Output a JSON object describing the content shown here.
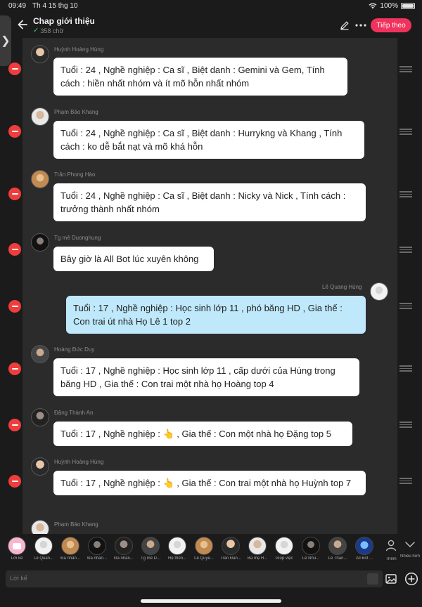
{
  "status": {
    "time": "09:49",
    "date": "Th 4 15 thg 10",
    "battery": "100%",
    "battery_level": 1.0
  },
  "header": {
    "title": "Chap giới thiệu",
    "word_count": "358 chữ",
    "follow_label": "Tiếp theo"
  },
  "messages": [
    {
      "sender": "Huỳnh Hoàng Hùng",
      "text": "Tuổi : 24 , Nghề nghiệp : Ca sĩ , Biệt danh :  Gemini và Gem, Tính cách : hiền nhất nhóm và ít mõ hỗn nhất nhóm"
    },
    {
      "sender": "Phạm Bảo Khang",
      "text": "Tuổi : 24 , Nghề nghiệp : Ca sĩ , Biệt danh : Hurrykng và Khang , Tính cách : ko dễ bắt nạt và mõ khá hỗn"
    },
    {
      "sender": "Trần Phong Hào",
      "text": "Tuổi : 24 , Nghề nghiệp : Ca sĩ , Biệt danh : Nicky và Nick , Tính cách : trưởng thành nhất nhóm"
    },
    {
      "sender": "Tg mê Duonghung",
      "text": "Bây giờ là All Bot lúc xuyên không"
    },
    {
      "sender": "Lê Quang Hùng",
      "text": "Tuổi : 17 , Nghề nghiệp : Học sinh lớp 11 , phó băng HD , Gia thế : Con trai út nhà Họ Lê 1 top 2"
    },
    {
      "sender": "Hoàng Đức Duy",
      "text": "Tuổi : 17 , Nghề nghiệp : Học sinh lớp 11 , cấp dưới của Hùng trong băng HD , Gia thế : Con trai một nhà họ Hoàng top 4"
    },
    {
      "sender": "Đặng Thành An",
      "text": "Tuổi : 17 , Nghề nghiệp : 👆 , Gia thế : Con một nhà họ Đặng top 5"
    },
    {
      "sender": "Huỳnh Hoàng Hùng",
      "text": "Tuổi : 17 , Nghề nghiệp : 👆 , Gia thế : Con trai một nhà họ Huỳnh top 7"
    },
    {
      "sender": "Phạm Bảo Khang"
    }
  ],
  "characters": [
    "Lời kể",
    "Lê Quan...",
    "Đa nhân...",
    "Đa nhân...",
    "Đa nhân...",
    "Tg mê D...",
    "Hệ thốn...",
    "Lê Quyề...",
    "Trần Đăn...",
    "Ba mẹ H...",
    "Giúp việc",
    "Lê Nhu...",
    "Lê Than...",
    "All Bot ..."
  ],
  "bottom": {
    "more_label": "Thêm",
    "many_label": "Nhiều hơn",
    "input_placeholder": "Lời kể"
  },
  "colors": {
    "accent": "#f0335c",
    "me_bubble": "#bfe9fb",
    "remove": "#ef3d3d"
  }
}
